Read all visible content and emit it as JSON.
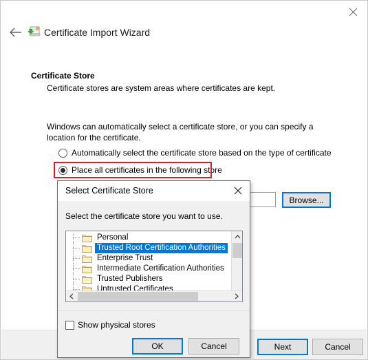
{
  "wizard": {
    "title": "Certificate Import Wizard",
    "icon": "certificate-import-icon",
    "back_icon": "back-arrow-icon",
    "close_icon": "close-icon",
    "page_heading": "Certificate Store",
    "page_subheading": "Certificate stores are system areas where certificates are kept.",
    "intro_text": "Windows can automatically select a certificate store, or you can specify a location for the certificate.",
    "options": [
      {
        "label": "Automatically select the certificate store based on the type of certificate",
        "selected": false
      },
      {
        "label": "Place all certificates in the following store",
        "selected": true
      }
    ],
    "store_field_value": "",
    "browse_label": "Browse...",
    "next_label": "Next",
    "cancel_label": "Cancel",
    "highlight_color": "#e01b24",
    "focus_color": "#0078d7"
  },
  "dialog": {
    "title": "Select Certificate Store",
    "close_icon": "close-icon",
    "instruction": "Select the certificate store you want to use.",
    "stores": [
      {
        "label": "Personal",
        "selected": false
      },
      {
        "label": "Trusted Root Certification Authorities",
        "selected": true
      },
      {
        "label": "Enterprise Trust",
        "selected": false
      },
      {
        "label": "Intermediate Certification Authorities",
        "selected": false
      },
      {
        "label": "Trusted Publishers",
        "selected": false
      },
      {
        "label": "Untrusted Certificates",
        "selected": false
      }
    ],
    "show_physical_stores_label": "Show physical stores",
    "show_physical_stores_checked": false,
    "ok_label": "OK",
    "cancel_label": "Cancel",
    "selection_color": "#0078d7"
  }
}
